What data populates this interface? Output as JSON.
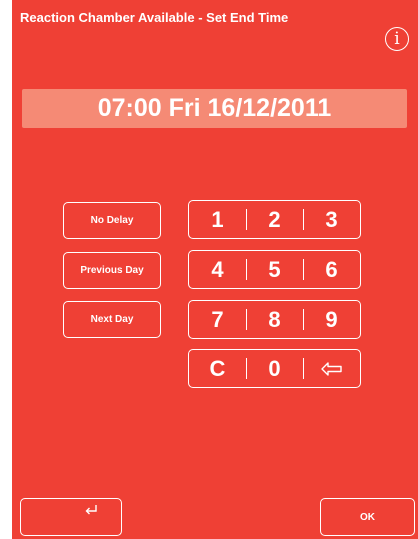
{
  "header": {
    "title": "Reaction Chamber Available - Set End Time",
    "info_icon": "info-icon",
    "info_glyph": "i"
  },
  "datetime_display": "07:00 Fri 16/12/2011",
  "options": {
    "no_delay": "No Delay",
    "previous_day": "Previous Day",
    "next_day": "Next Day"
  },
  "keypad": {
    "row1": [
      "1",
      "2",
      "3"
    ],
    "row2": [
      "4",
      "5",
      "6"
    ],
    "row3": [
      "7",
      "8",
      "9"
    ],
    "clear": "C",
    "zero": "0",
    "backspace_icon": "backspace-arrow-icon"
  },
  "footer": {
    "back_icon": "return-arrow-icon",
    "ok_label": "OK"
  },
  "colors": {
    "screen_background": "#ef4035",
    "display_background": "#f58a75",
    "foreground": "#ffffff"
  }
}
